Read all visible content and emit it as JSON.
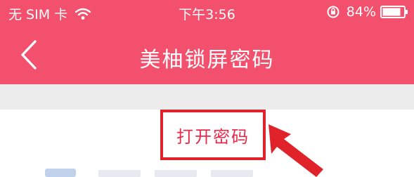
{
  "status_bar": {
    "carrier": "无 SIM 卡",
    "time": "下午3:56",
    "battery": "84%"
  },
  "nav": {
    "title": "美柚锁屏密码"
  },
  "settings": {
    "open_password_label": "打开密码"
  },
  "colors": {
    "header": "#f2506d",
    "highlight_border": "#e0232a",
    "label_text": "#e8294a",
    "divider_gray": "#ececec"
  },
  "icons": [
    "wifi-icon",
    "rotation-lock-icon",
    "battery-icon",
    "back-icon",
    "arrow-icon"
  ]
}
